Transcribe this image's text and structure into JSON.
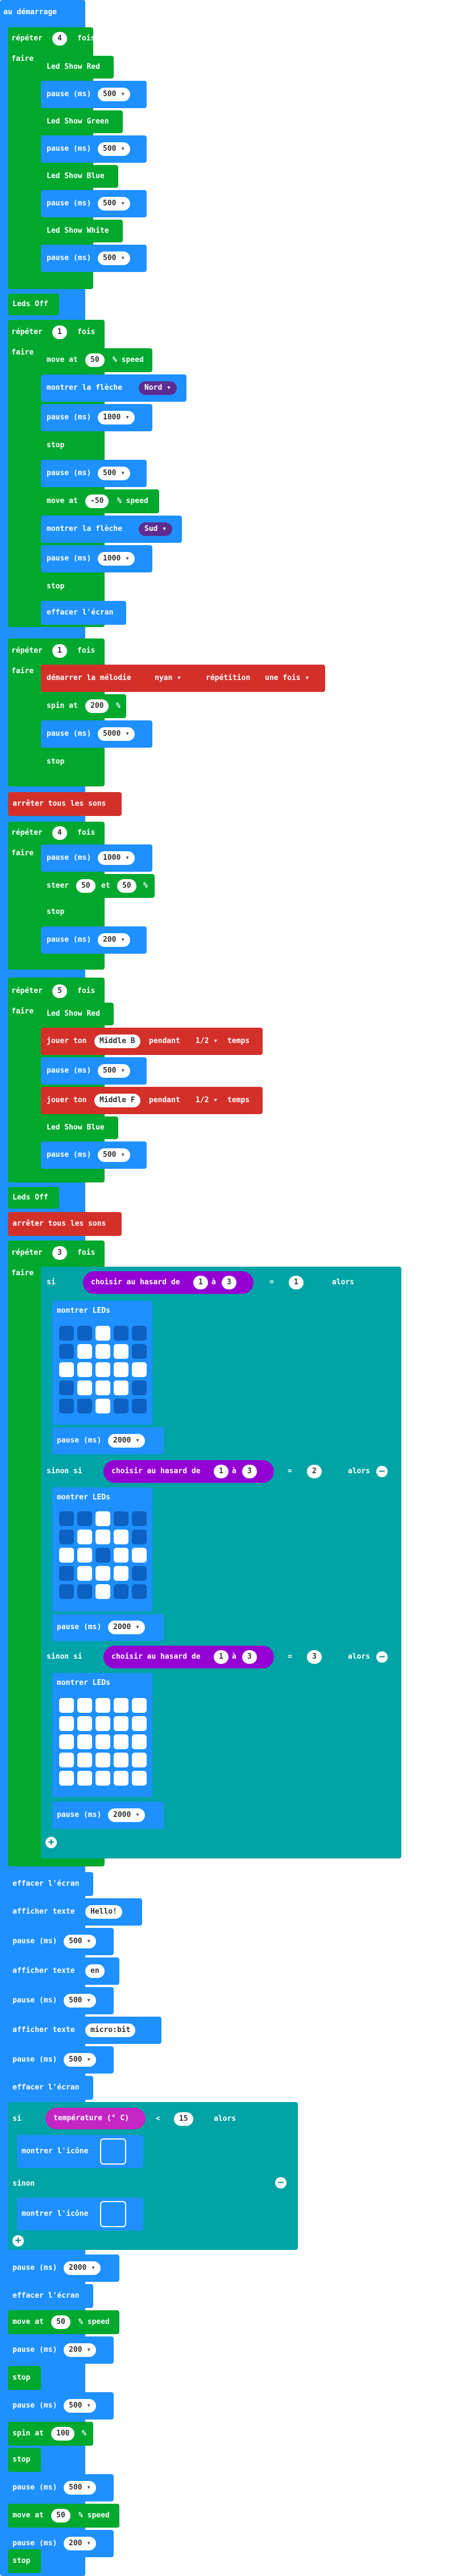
{
  "program": {
    "on_start": "au démarrage",
    "repeat_1": {
      "label": "répéter",
      "count": "4",
      "times": "fois",
      "do": "faire"
    },
    "led_red": "Led Show Red",
    "led_green": "Led Show Green",
    "led_blue": "Led Show Blue",
    "led_white": "Led Show White",
    "pause_label": "pause (ms)",
    "p500": "500",
    "p1000": "1000",
    "p2000": "2000",
    "p200": "200",
    "p5000": "5000",
    "leds_off": "Leds Off",
    "repeat_2": {
      "count": "1"
    },
    "move_at": "move at",
    "pct_speed": "% speed",
    "speed_50": "50",
    "speed_m50": "-50",
    "show_arrow": "montrer la flèche",
    "north": "Nord",
    "south": "Sud",
    "stop": "stop",
    "clear_screen": "effacer l'écran",
    "repeat_3": {
      "count": "1"
    },
    "play_melody": "démarrer la mélodie",
    "melody": "nyan",
    "repetition": "répétition",
    "once": "une fois",
    "spin_at": "spin at",
    "spin_200": "200",
    "spin_100": "100",
    "pct": "%",
    "stop_all": "arrêter tous les sons",
    "repeat_4": {
      "count": "4"
    },
    "steer": "steer",
    "steer_a": "50",
    "and": "et",
    "steer_b": "50",
    "repeat_5": {
      "count": "5"
    },
    "play_tone": "jouer ton",
    "middle_b": "Middle B",
    "middle_f": "Middle F",
    "for": "pendant",
    "half_beat": "1/2",
    "beat": "temps",
    "repeat_6": {
      "count": "3"
    },
    "if": "si",
    "else_if": "sinon si",
    "else": "sinon",
    "then": "alors",
    "random_pick": "choisir au hasard de",
    "to": "à",
    "r1": "1",
    "r3": "3",
    "eq": "=",
    "v1": "1",
    "v2": "2",
    "v3": "3",
    "show_leds": "montrer LEDs",
    "show_text": "afficher texte",
    "text_hello": "Hello!",
    "text_en": "en",
    "text_microbit": "micro:bit",
    "temperature": "température (° C)",
    "lt": "<",
    "temp_value": "15",
    "show_icon": "montrer l'icône",
    "plus": "+",
    "minus": "−"
  },
  "led_patterns": {
    "grid_1": [
      [
        0,
        0,
        1,
        0,
        0
      ],
      [
        0,
        1,
        1,
        1,
        0
      ],
      [
        1,
        1,
        1,
        1,
        1
      ],
      [
        0,
        1,
        1,
        1,
        0
      ],
      [
        0,
        0,
        1,
        0,
        0
      ]
    ],
    "grid_2": [
      [
        0,
        0,
        1,
        0,
        0
      ],
      [
        0,
        1,
        1,
        1,
        0
      ],
      [
        1,
        1,
        0,
        1,
        1
      ],
      [
        0,
        1,
        1,
        1,
        0
      ],
      [
        0,
        0,
        1,
        0,
        0
      ]
    ],
    "grid_3": [
      [
        1,
        1,
        1,
        1,
        1
      ],
      [
        1,
        1,
        1,
        1,
        1
      ],
      [
        1,
        1,
        1,
        1,
        1
      ],
      [
        1,
        1,
        1,
        1,
        1
      ],
      [
        1,
        1,
        1,
        1,
        1
      ]
    ]
  },
  "colors": {
    "events": "#1e90ff",
    "loops": "#00a82d",
    "basic": "#1e90ff",
    "music": "#d4302a",
    "logic": "#00a4a6",
    "math": "#9400d3",
    "led_dropdown": "#5c2d91"
  }
}
